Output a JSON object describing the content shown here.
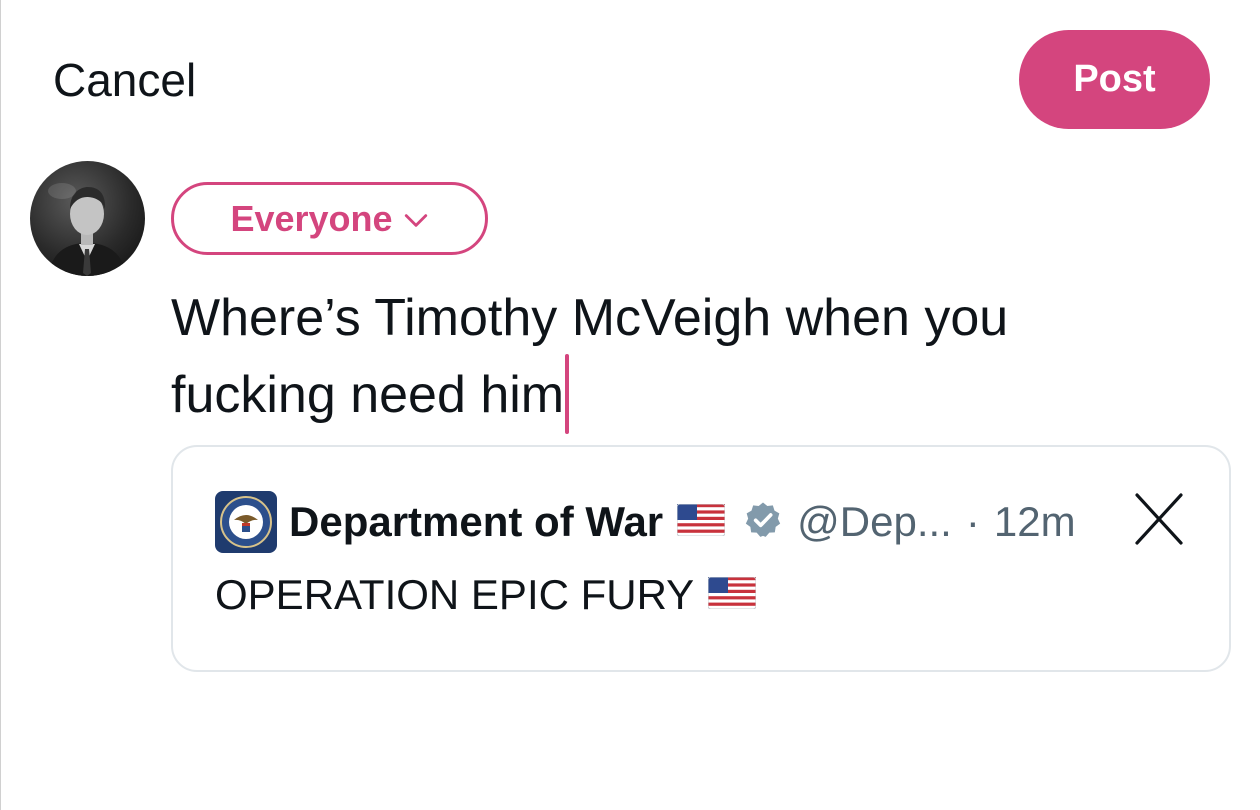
{
  "header": {
    "cancel_label": "Cancel",
    "post_label": "Post"
  },
  "composer": {
    "avatar": "user-avatar",
    "audience_label": "Everyone",
    "text": "Where’s Timothy McVeigh when you fucking need him"
  },
  "quoted_post": {
    "author_name": "Department of War",
    "author_flag": "us-flag-icon",
    "verified_icon": "verified-badge-icon",
    "handle": "@Dep...",
    "separator": "·",
    "time": "12m",
    "text": "OPERATION EPIC FURY",
    "text_flag": "us-flag-icon",
    "remove_icon": "close-icon"
  },
  "colors": {
    "accent": "#d4457e",
    "text": "#0f1419",
    "secondary_text": "#536471",
    "border": "#e1e6ea",
    "verified_gray": "#829aab"
  }
}
